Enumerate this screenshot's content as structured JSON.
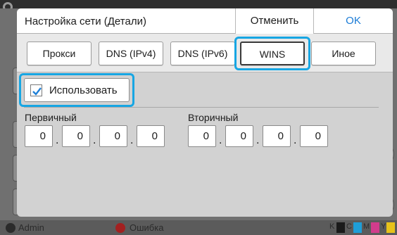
{
  "dialog": {
    "title": "Настройка сети (Детали)",
    "cancel_label": "Отменить",
    "ok_label": "OK"
  },
  "tabs": [
    {
      "label": "Прокси",
      "selected": false
    },
    {
      "label": "DNS (IPv4)",
      "selected": false
    },
    {
      "label": "DNS (IPv6)",
      "selected": false
    },
    {
      "label": "WINS",
      "selected": true
    },
    {
      "label": "Иное",
      "selected": false
    }
  ],
  "wins": {
    "use_label": "Использовать",
    "use_checked": true,
    "primary_label": "Первичный",
    "primary": [
      "0",
      "0",
      "0",
      "0"
    ],
    "secondary_label": "Вторичный",
    "secondary": [
      "0",
      "0",
      "0",
      "0"
    ]
  },
  "status_bar": {
    "user": "Admin",
    "error": "Ошибка",
    "inks": [
      "K",
      "C",
      "M",
      "Y"
    ]
  },
  "colors": {
    "highlight": "#17a6e3",
    "ok_text": "#1a7bd6",
    "ink_K": "#1a1a1a",
    "ink_C": "#1e9ed8",
    "ink_M": "#d23c8c",
    "ink_Y": "#e7c21a"
  },
  "icons": {
    "settings": "gear-icon",
    "check": "checkmark-icon",
    "user": "user-icon",
    "error": "error-icon"
  }
}
